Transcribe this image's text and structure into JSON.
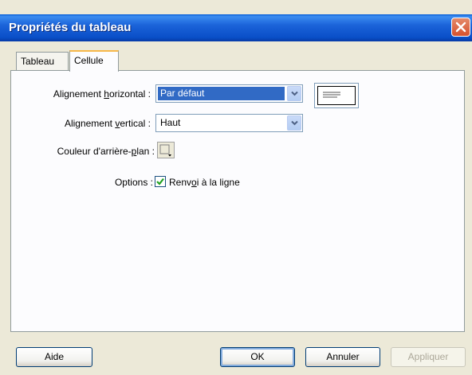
{
  "window": {
    "title": "Propriétés du tableau"
  },
  "tabs": [
    {
      "label": "Tableau",
      "active": false
    },
    {
      "label": "Cellule",
      "active": true
    }
  ],
  "fields": {
    "halign": {
      "label_pre": "Alignement ",
      "label_u": "h",
      "label_post": "orizontal :",
      "value": "Par défaut"
    },
    "valign": {
      "label_pre": "Alignement ",
      "label_u": "v",
      "label_post": "ertical :",
      "value": "Haut"
    },
    "bgcolor": {
      "label_pre": "Couleur d'arrière-",
      "label_u": "p",
      "label_post": "lan :"
    },
    "options": {
      "label": "Options :",
      "wrap_pre": "Renv",
      "wrap_u": "o",
      "wrap_post": "i à la ligne",
      "wrap_checked": true
    }
  },
  "buttons": {
    "help": "Aide",
    "ok": "OK",
    "cancel": "Annuler",
    "apply": "Appliquer"
  },
  "colors": {
    "titlebar": "#0A4FC8",
    "selection": "#316AC5",
    "check": "#21A121"
  }
}
